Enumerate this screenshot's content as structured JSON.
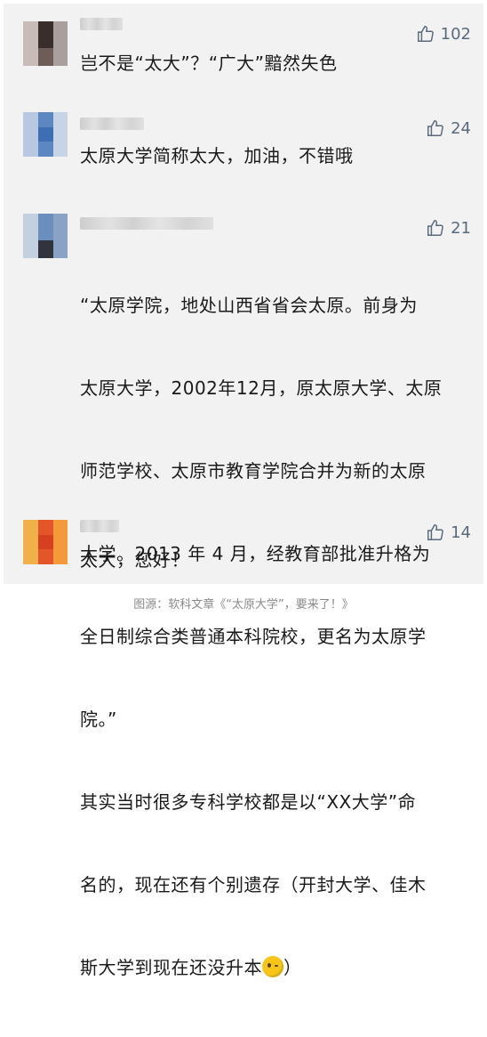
{
  "comments": [
    {
      "likes": "102",
      "text": "岂不是“太大”？“广大”黯然失色"
    },
    {
      "likes": "24",
      "text": "太原大学简称太大，加油，不错哦"
    },
    {
      "likes": "21",
      "text_lines": [
        "“太原学院，地处山西省省会太原。前身为",
        "太原大学，2002年12月，原太原大学、太原",
        "师范学校、太原市教育学院合并为新的太原",
        "大学。2013 年 4 月，经教育部批准升格为",
        "全日制综合类普通本科院校，更名为太原学",
        "院。”",
        "其实当时很多专科学校都是以“XX大学”命",
        "名的，现在还有个别遗存（开封大学、佳木",
        "斯大学到现在还没升本"
      ],
      "text_tail": "）"
    },
    {
      "likes": "14",
      "text": "太大，您好！"
    }
  ],
  "icons": {
    "like": "thumbs-up-icon",
    "emoji": "wink-emoji-icon"
  },
  "caption": "图源：软科文章《“太原大学”，要来了！》"
}
